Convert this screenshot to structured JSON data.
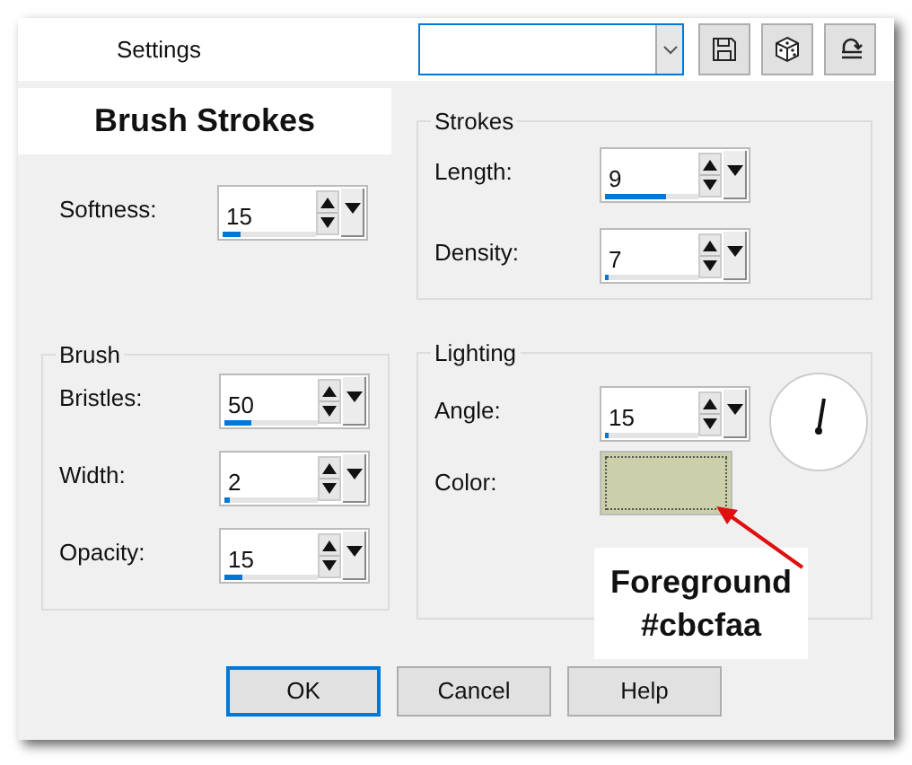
{
  "header": {
    "title": "Settings"
  },
  "banner": "Brush Strokes",
  "softness": {
    "label": "Softness:",
    "value": "15",
    "level": 0.2
  },
  "strokes": {
    "title": "Strokes",
    "fields": [
      {
        "label": "Length:",
        "value": "9",
        "level": 0.65
      },
      {
        "label": "Density:",
        "value": "7",
        "level": 0.04
      }
    ]
  },
  "brush": {
    "title": "Brush",
    "fields": [
      {
        "label": "Bristles:",
        "value": "50",
        "level": 0.28
      },
      {
        "label": "Width:",
        "value": "2",
        "level": 0.06
      },
      {
        "label": "Opacity:",
        "value": "15",
        "level": 0.2
      }
    ]
  },
  "lighting": {
    "title": "Lighting",
    "angle": {
      "label": "Angle:",
      "value": "15",
      "level": 0.04
    },
    "color": {
      "label": "Color:",
      "color": "#cbcfaa"
    }
  },
  "annotation": {
    "lines": [
      "Foreground",
      "#cbcfaa"
    ]
  },
  "buttons": [
    {
      "label": "OK",
      "focused": true
    },
    {
      "label": "Cancel",
      "focused": false
    },
    {
      "label": "Help",
      "focused": false
    }
  ]
}
